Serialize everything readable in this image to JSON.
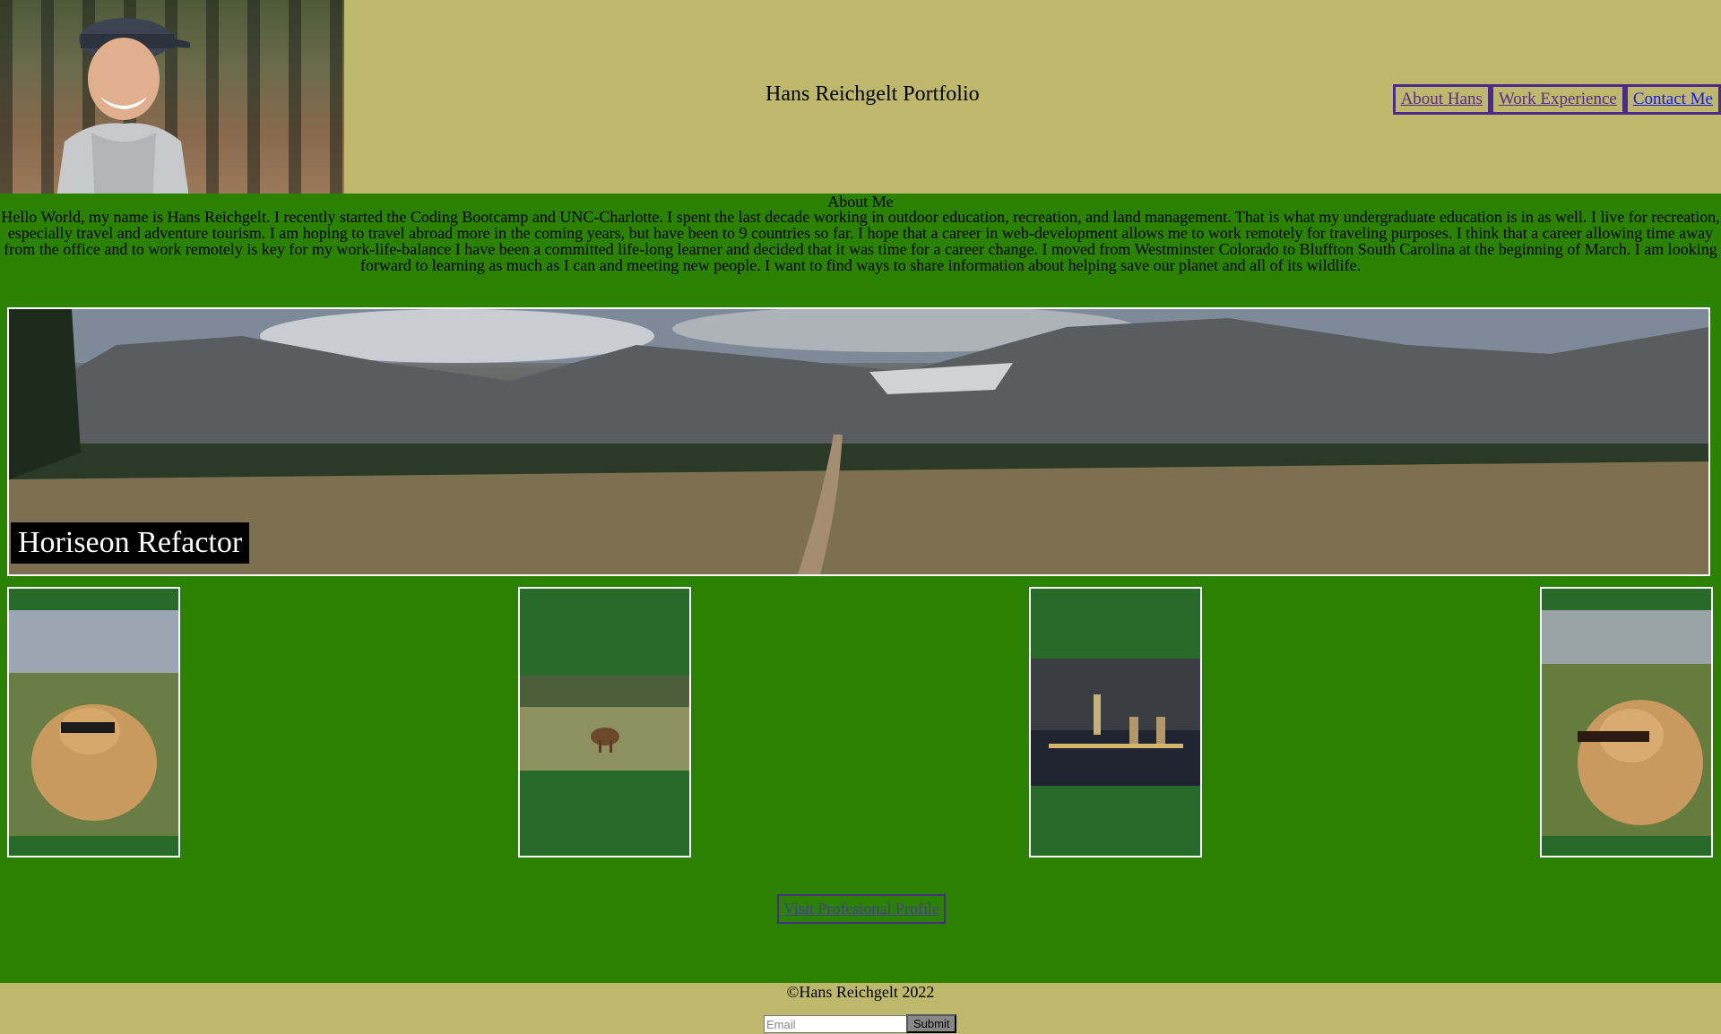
{
  "header": {
    "title": "Hans Reichgelt Portfolio",
    "nav": [
      {
        "label": "About Hans"
      },
      {
        "label": "Work Experience"
      },
      {
        "label": "Contact Me"
      }
    ]
  },
  "about": {
    "heading": "About Me",
    "text": "Hello World, my name is Hans Reichgelt. I recently started the Coding Bootcamp and UNC-Charlotte. I spent the last decade working in outdoor education, recreation, and land management. That is what my undergraduate education is in as well. I live for recreation, especially travel and adventure tourism. I am hoping to travel abroad more in the coming years, but have been to 9 countries so far. I hope that a career in web-development allows me to work remotely for traveling purposes. I think that a career allowing time away from the office and to work remotely is key for my work-life-balance I have been a committed life-long learner and decided that it was time for a career change. I moved from Westminster Colorado to Bluffton South Carolina at the beginning of March. I am looking forward to learning as much as I can and meeting new people. I want to find ways to share information about helping save our planet and all of its wildlife."
  },
  "hero": {
    "caption": "Horiseon Refactor"
  },
  "profile_link": {
    "label": "Visit Profesional Profile"
  },
  "footer": {
    "copyright": "©Hans Reichgelt 2022",
    "email_placeholder": "Email",
    "submit_label": "Submit"
  },
  "colors": {
    "header_bg": "#bdb86b",
    "main_bg": "#2a8200",
    "nav_border": "#4a2a8a"
  }
}
